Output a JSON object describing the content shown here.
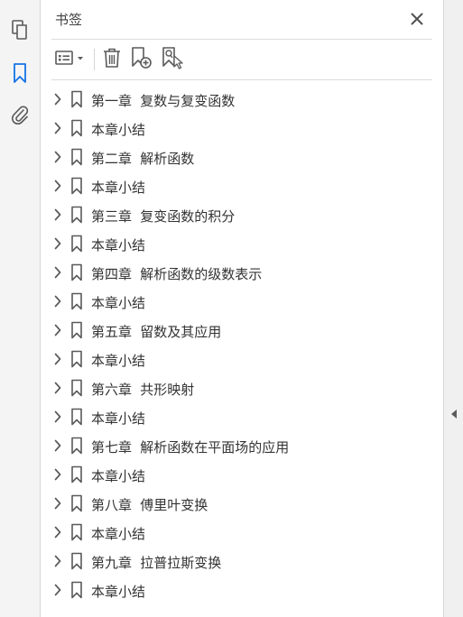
{
  "rail": {
    "items": [
      {
        "icon": "page-thumbnails-icon",
        "active": false
      },
      {
        "icon": "bookmark-icon",
        "active": true
      },
      {
        "icon": "attachment-icon",
        "active": false
      }
    ]
  },
  "panel": {
    "title": "书签",
    "toolbar": {
      "icons": [
        "options-menu-icon",
        "delete-bookmark-icon",
        "new-bookmark-icon",
        "find-current-bookmark-icon"
      ]
    }
  },
  "bookmarks": [
    {
      "label": "第一章 复数与复变函数"
    },
    {
      "label": "本章小结"
    },
    {
      "label": "第二章 解析函数"
    },
    {
      "label": "本章小结"
    },
    {
      "label": "第三章 复变函数的积分"
    },
    {
      "label": "本章小结"
    },
    {
      "label": "第四章 解析函数的级数表示"
    },
    {
      "label": "本章小结"
    },
    {
      "label": "第五章 留数及其应用"
    },
    {
      "label": "本章小结"
    },
    {
      "label": "第六章 共形映射"
    },
    {
      "label": "本章小结"
    },
    {
      "label": "第七章 解析函数在平面场的应用"
    },
    {
      "label": "本章小结"
    },
    {
      "label": "第八章 傅里叶变换"
    },
    {
      "label": "本章小结"
    },
    {
      "label": "第九章 拉普拉斯变换"
    },
    {
      "label": "本章小结"
    }
  ],
  "colors": {
    "accent": "#1473e6",
    "icon": "#5a5a5a",
    "text": "#333333"
  }
}
